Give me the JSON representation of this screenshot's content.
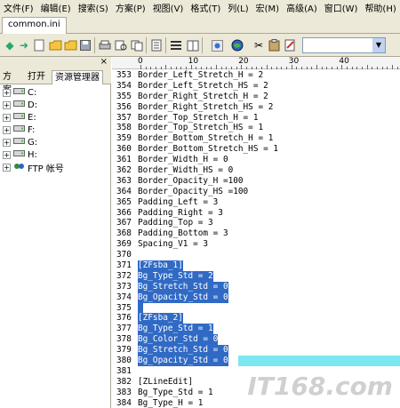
{
  "menubar": {
    "items": [
      {
        "label": "文件(F)"
      },
      {
        "label": "编辑(E)"
      },
      {
        "label": "搜索(S)"
      },
      {
        "label": "方案(P)"
      },
      {
        "label": "视图(V)"
      },
      {
        "label": "格式(T)"
      },
      {
        "label": "列(L)"
      },
      {
        "label": "宏(M)"
      },
      {
        "label": "高级(A)"
      },
      {
        "label": "窗口(W)"
      },
      {
        "label": "帮助(H)"
      }
    ]
  },
  "tabs": {
    "document": "common.ini"
  },
  "toolbar": {
    "combo_value": ""
  },
  "leftpane": {
    "tabs": [
      "方案",
      "打开",
      "资源管理器"
    ],
    "active_tab": 2,
    "tree": [
      {
        "label": "C:",
        "icon": "drive-icon"
      },
      {
        "label": "D:",
        "icon": "drive-icon"
      },
      {
        "label": "E:",
        "icon": "drive-icon"
      },
      {
        "label": "F:",
        "icon": "drive-icon"
      },
      {
        "label": "G:",
        "icon": "drive-icon"
      },
      {
        "label": "H:",
        "icon": "drive-icon"
      },
      {
        "label": "FTP 帐号",
        "icon": "ftp-icon"
      }
    ]
  },
  "ruler": {
    "labels": [
      "0",
      "10",
      "20",
      "30",
      "40"
    ]
  },
  "editor": {
    "lines": [
      {
        "n": "353",
        "text": "Border_Left_Stretch_H = 2",
        "sel": false
      },
      {
        "n": "354",
        "text": "Border_Left_Stretch_HS = 2",
        "sel": false
      },
      {
        "n": "355",
        "text": "Border_Right_Stretch_H = 2",
        "sel": false
      },
      {
        "n": "356",
        "text": "Border_Right_Stretch_HS = 2",
        "sel": false
      },
      {
        "n": "357",
        "text": "Border_Top_Stretch_H = 1",
        "sel": false
      },
      {
        "n": "358",
        "text": "Border_Top_Stretch_HS = 1",
        "sel": false
      },
      {
        "n": "359",
        "text": "Border_Bottom_Stretch_H = 1",
        "sel": false
      },
      {
        "n": "360",
        "text": "Border_Bottom_Stretch_HS = 1",
        "sel": false
      },
      {
        "n": "361",
        "text": "Border_Width_H = 0",
        "sel": false
      },
      {
        "n": "362",
        "text": "Border_Width_HS = 0",
        "sel": false
      },
      {
        "n": "363",
        "text": "Border_Opacity_H =100",
        "sel": false
      },
      {
        "n": "364",
        "text": "Border_Opacity_HS =100",
        "sel": false
      },
      {
        "n": "365",
        "text": "Padding_Left = 3",
        "sel": false
      },
      {
        "n": "366",
        "text": "Padding_Right = 3",
        "sel": false
      },
      {
        "n": "367",
        "text": "Padding_Top = 3",
        "sel": false
      },
      {
        "n": "368",
        "text": "Padding_Bottom = 3",
        "sel": false
      },
      {
        "n": "369",
        "text": "Spacing_V1 = 3",
        "sel": false
      },
      {
        "n": "370",
        "text": "",
        "sel": false
      },
      {
        "n": "371",
        "text": "[ZFsba_1]",
        "sel": true
      },
      {
        "n": "372",
        "text": "Bg_Type_Std = 2",
        "sel": true
      },
      {
        "n": "373",
        "text": "Bg_Stretch_Std = 0",
        "sel": true
      },
      {
        "n": "374",
        "text": "Bg_Opacity_Std = 0",
        "sel": true
      },
      {
        "n": "375",
        "text": " ",
        "sel": true
      },
      {
        "n": "376",
        "text": "[ZFsba_2]",
        "sel": true
      },
      {
        "n": "377",
        "text": "Bg_Type_Std = 1",
        "sel": true
      },
      {
        "n": "378",
        "text": "Bg_Color_Std = 0",
        "sel": true
      },
      {
        "n": "379",
        "text": "Bg_Stretch_Std = 0",
        "sel": true
      },
      {
        "n": "380",
        "text": "Bg_Opacity_Std = 0",
        "sel": true,
        "cursor": true
      },
      {
        "n": "381",
        "text": "",
        "sel": false
      },
      {
        "n": "382",
        "text": "[ZLineEdit]",
        "sel": false
      },
      {
        "n": "383",
        "text": "Bg_Type_Std = 1",
        "sel": false
      },
      {
        "n": "384",
        "text": "Bg_Type_H = 1",
        "sel": false
      }
    ]
  },
  "watermark": "IT168.com"
}
